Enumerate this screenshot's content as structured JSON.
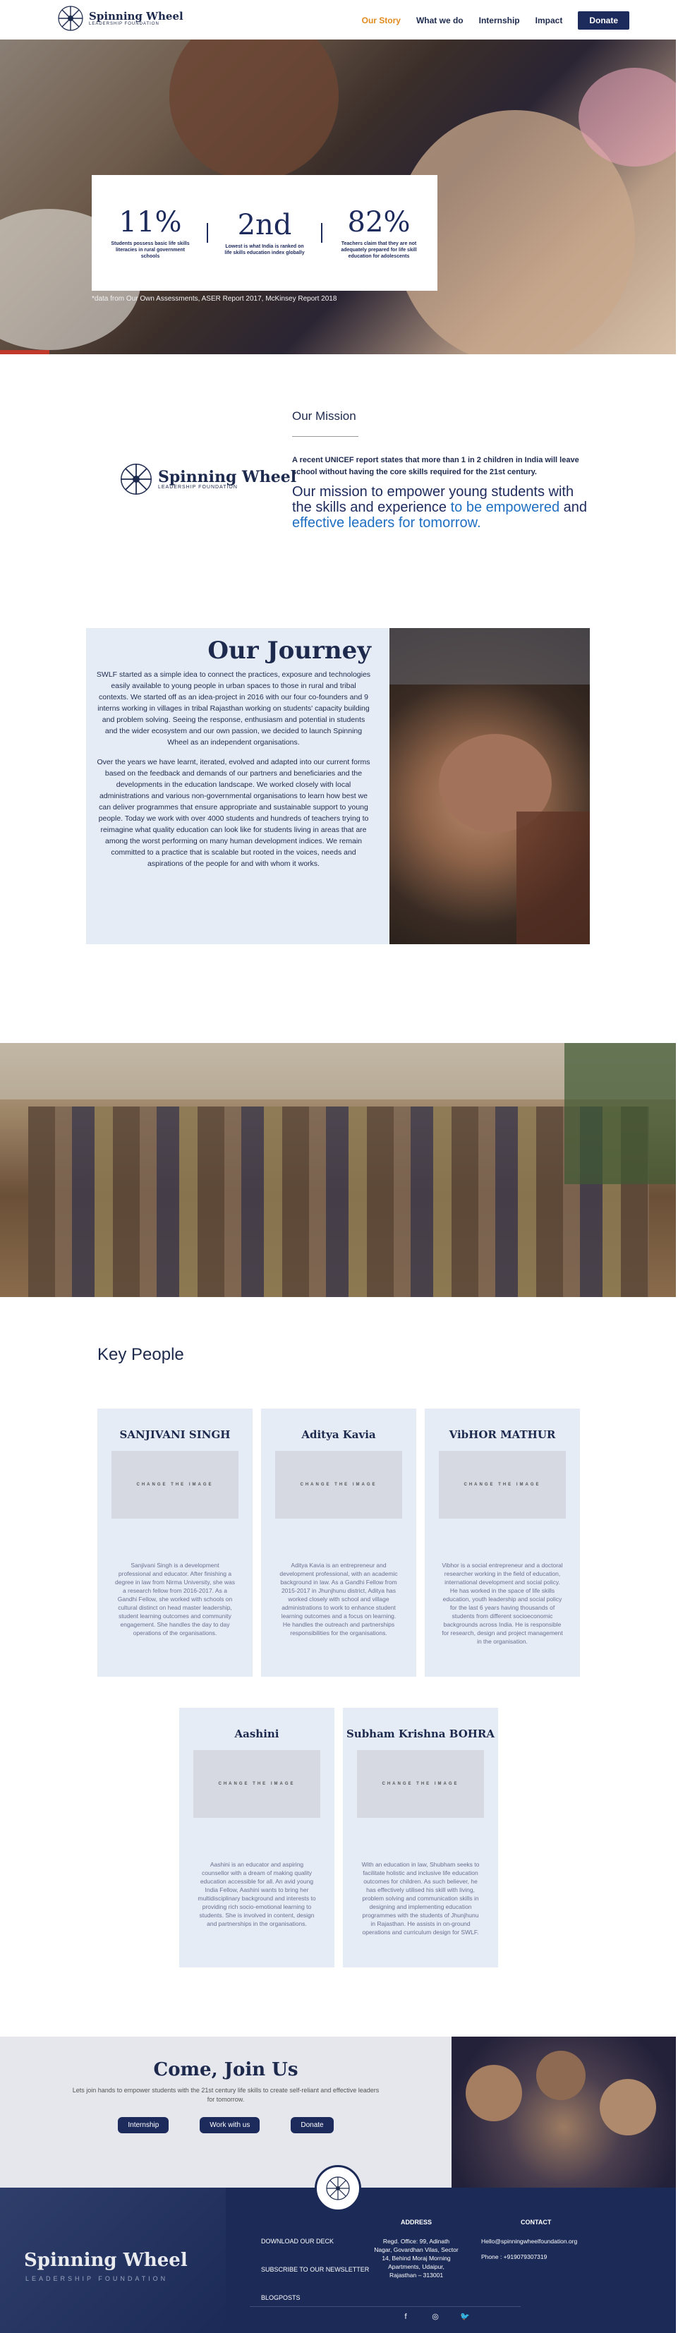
{
  "nav": {
    "logo_main": "Spinning Wheel",
    "logo_sub": "LEADERSHIP FOUNDATION",
    "links": [
      "Our Story",
      "What we do",
      "Internship",
      "Impact"
    ],
    "donate": "Donate"
  },
  "hero": {
    "stats": [
      {
        "num": "11%",
        "text": "Students possess basic life skills literacies in rural government schools"
      },
      {
        "num": "2nd",
        "text": "Lowest is what India is ranked on life skills education index globally"
      },
      {
        "num": "82%",
        "text": "Teachers claim that they are not adequately prepared for life skill education for adolescents"
      }
    ],
    "caption": "*data from Our Own Assessments, ASER Report 2017, McKinsey Report 2018"
  },
  "mission": {
    "title": "Our Mission",
    "report": "A recent UNICEF report states that more than 1 in 2 children in India will leave school without having the core skills required for the 21st century.",
    "statement_a": "Our mission to empower young students with the skills and experience ",
    "statement_hl1": "to be empowered",
    "statement_b": " and ",
    "statement_hl2": "effective leaders for tomorrow."
  },
  "journey": {
    "title": "Our Journey",
    "p1": "SWLF started as a simple idea to connect the practices, exposure and technologies easily available to young people in urban spaces to those in rural and tribal contexts. We started off as an idea-project in 2016 with our four co-founders and 9 interns working in villages in tribal Rajasthan working on students' capacity building and problem solving. Seeing the response, enthusiasm and potential in students and the wider ecosystem and our own passion, we decided to launch Spinning Wheel as an independent organisations.",
    "p2": "Over the years we have learnt, iterated, evolved and adapted into our current forms based on the feedback and demands of our partners and beneficiaries and the developments in the education landscape. We worked closely with local administrations and various non-governmental organisations to learn how best we can deliver programmes that ensure appropriate and sustainable support to young people. Today we work with over 4000 students and hundreds of teachers trying to reimagine what quality education can look like for students living in areas that are among the worst performing on many human development indices. We remain committed to a practice that is scalable but rooted in the voices, needs and aspirations of the people for and with whom it works."
  },
  "people": {
    "title": "Key People",
    "image_label": "CHANGE THE IMAGE",
    "cards": [
      {
        "name": "SANJIVANI SINGH",
        "bio": "Sanjivani Singh is a development professional and educator. After finishing a degree in law from Nirma University, she was a research fellow from 2016-2017. As a Gandhi Fellow, she worked with schools on cultural distinct on head master leadership, student learning outcomes and community engagement. She handles the day to day operations of the organisations."
      },
      {
        "name": "Aditya Kavia",
        "bio": "Aditya Kavia is an entrepreneur and development professional, with an academic background in law. As a Gandhi Fellow from 2015-2017 in Jhunjhunu district, Aditya has worked closely with school and village administrations to work to enhance student learning outcomes and a focus on learning. He handles the outreach and partnerships responsibilities for the organisations."
      },
      {
        "name": "VibHOR MATHUR",
        "bio": "Vibhor is a social entrepreneur and a doctoral researcher working in the field of education, international development and social policy. He has worked in the space of life skills education, youth leadership and social policy for the last 6 years having thousands of students from different socioeconomic backgrounds across India. He is responsible for research, design and project management in the organisation."
      },
      {
        "name": "Aashini",
        "bio": "Aashini is an educator and aspiring counsellor with a dream of making quality education accessible for all. An avid young India Fellow, Aashini wants to bring her multidisciplinary background and interests to providing rich socio-emotional learning to students. She is involved in content, design and partnerships in the organisations."
      },
      {
        "name": "Subham Krishna BOHRA",
        "bio": "With an education in law, Shubham seeks to facilitate holistic and inclusive life education outcomes for children. As such believer, he has effectively utilised his skill with living, problem solving and communication skills in designing and implementing education programmes with the students of Jhunjhunu in Rajasthan. He assists in on-ground operations and curriculum design for SWLF."
      }
    ]
  },
  "join": {
    "title": "Come, Join Us",
    "text": "Lets join hands to empower students with the 21st century life skills to create self-reliant and effective leaders for tomorrow.",
    "buttons": [
      "Internship",
      "Work with us",
      "Donate"
    ]
  },
  "footer": {
    "brand": "Spinning Wheel",
    "brand_sub": "LEADERSHIP FOUNDATION",
    "links": [
      "DOWNLOAD OUR DECK",
      "SUBSCRIBE TO OUR NEWSLETTER",
      "BLOGPOSTS"
    ],
    "address_title": "ADDRESS",
    "address": "Regd. Office: 99, Adinath Nagar, Govardhan Vilas, Sector 14, Behind Moraj Morning Apartments, Udaipur, Rajasthan – 313001",
    "contact_title": "CONTACT",
    "email": "Hello@spinningwheelfoundation.org",
    "phone": "Phone : +919079307319",
    "social": [
      "f",
      "◎",
      "🐦"
    ]
  },
  "colors": {
    "primary": "#1d2a5c",
    "accent": "#e08a1e",
    "highlight": "#1f6fc2",
    "panel": "#e5ecf6"
  }
}
